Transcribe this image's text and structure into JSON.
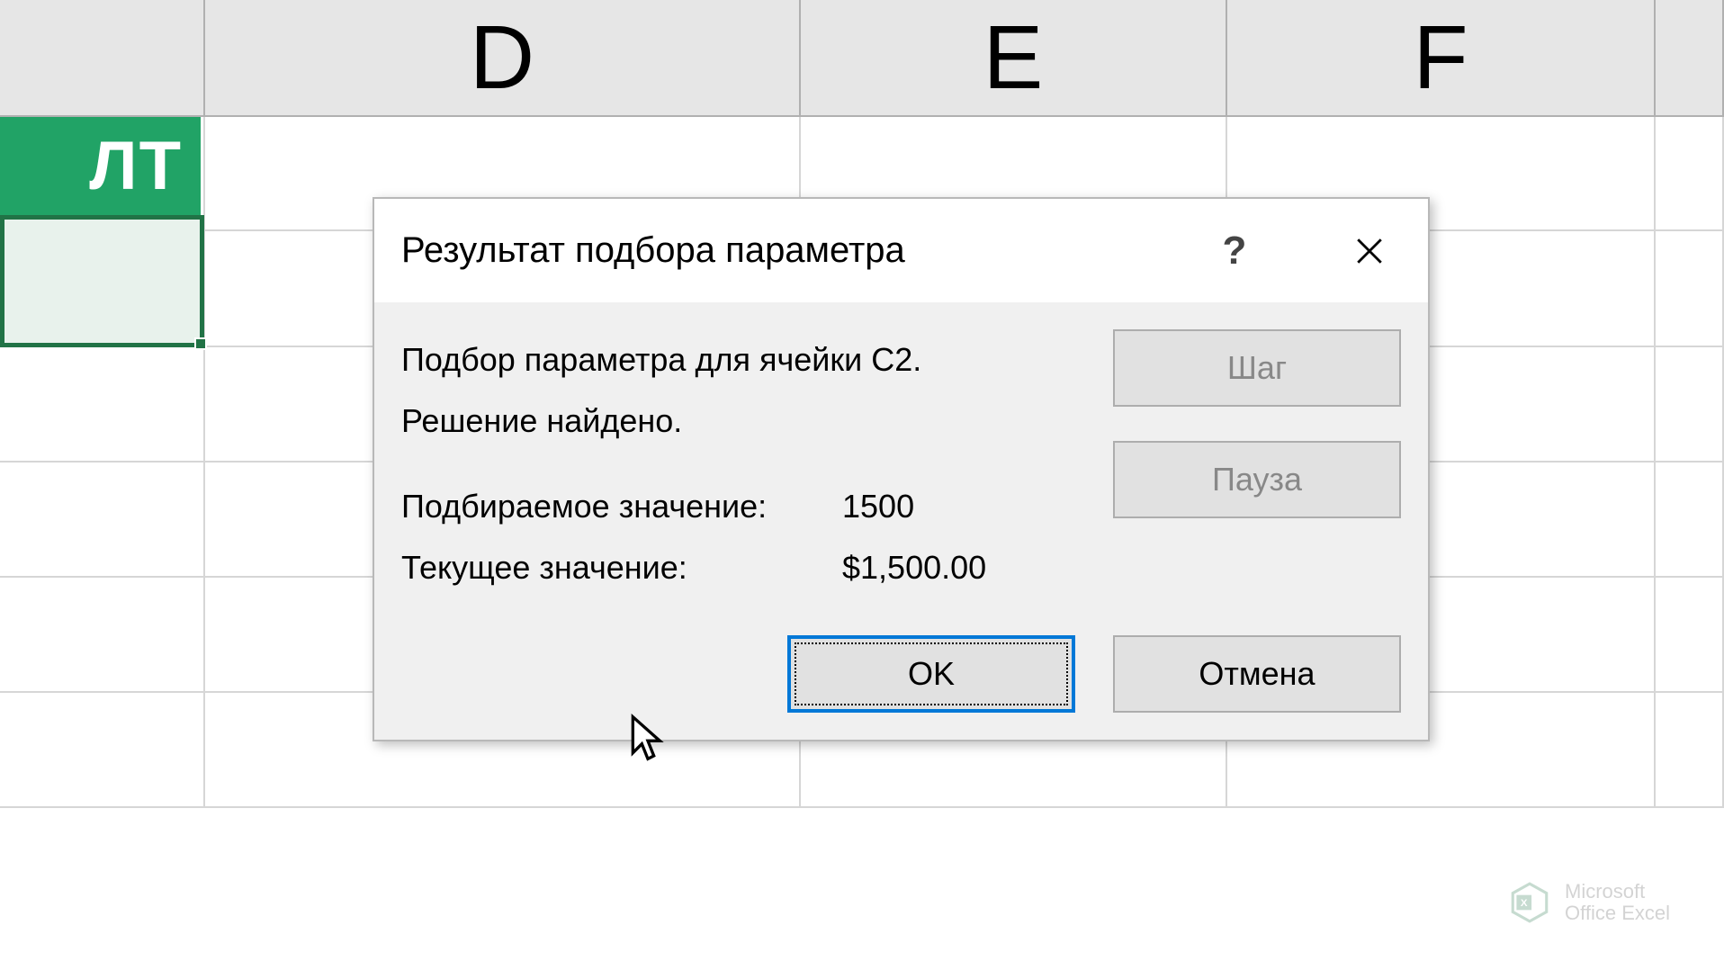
{
  "grid": {
    "columns": [
      "D",
      "E",
      "F"
    ],
    "partial_header_text": "ЛТ"
  },
  "dialog": {
    "title": "Результат подбора параметра",
    "message_line1": "Подбор параметра для ячейки C2.",
    "message_line2": "Решение найдено.",
    "target_label": "Подбираемое значение:",
    "target_value": "1500",
    "current_label": "Текущее значение:",
    "current_value": "$1,500.00",
    "buttons": {
      "step": "Шаг",
      "pause": "Пауза",
      "ok": "OK",
      "cancel": "Отмена"
    }
  },
  "watermark": {
    "line1": "Microsoft",
    "line2": "Office Excel"
  }
}
